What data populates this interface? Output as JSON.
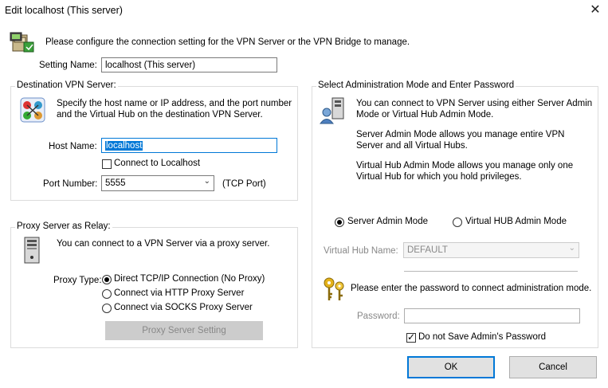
{
  "window": {
    "title": "Edit localhost (This server)",
    "close_label": "✕"
  },
  "intro": {
    "text": "Please configure the connection setting for the VPN Server or the VPN Bridge to manage."
  },
  "setting_name": {
    "label": "Setting Name:",
    "value": "localhost (This server)"
  },
  "destination": {
    "legend": "Destination VPN Server:",
    "description": [
      "Specify the host name or IP address, and the port number",
      "and the Virtual Hub on the destination VPN Server."
    ],
    "host_label": "Host Name:",
    "host_value": "localhost",
    "connect_localhost_label": "Connect to Localhost",
    "port_label": "Port Number:",
    "port_value": "5555",
    "port_suffix": "(TCP Port)"
  },
  "proxy": {
    "legend": "Proxy Server as Relay:",
    "description": "You can connect to a VPN Server via a proxy server.",
    "type_label": "Proxy Type:",
    "options": [
      "Direct TCP/IP Connection (No Proxy)",
      "Connect via HTTP Proxy Server",
      "Connect via SOCKS Proxy Server"
    ],
    "setting_button": "Proxy Server Setting"
  },
  "admin": {
    "legend": "Select Administration Mode and Enter Password",
    "para1": [
      "You can connect to VPN Server using either Server Admin",
      "Mode or Virtual Hub Admin Mode."
    ],
    "para2": [
      "Server Admin Mode allows you manage entire VPN",
      "Server and all Virtual Hubs."
    ],
    "para3": [
      "Virtual Hub Admin Mode allows you manage only one",
      "Virtual Hub for which you hold privileges."
    ],
    "server_mode_label": "Server Admin Mode",
    "hub_mode_label": "Virtual HUB Admin Mode",
    "hub_name_label": "Virtual Hub Name:",
    "hub_name_value": "DEFAULT",
    "password_prompt": "Please enter the password to connect administration mode.",
    "password_label": "Password:",
    "password_value": "",
    "no_save_label": "Do not Save Admin's Password"
  },
  "buttons": {
    "ok": "OK",
    "cancel": "Cancel"
  },
  "colors": {
    "accent": "#0078d7",
    "group_border": "#dcdcdc",
    "disabled_text": "#888888"
  }
}
